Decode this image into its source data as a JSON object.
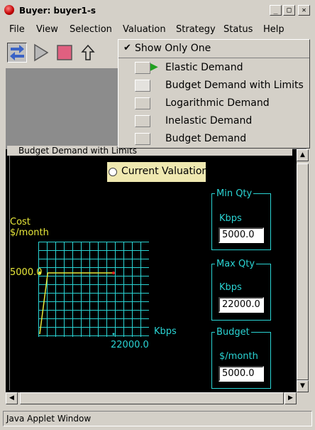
{
  "window": {
    "title": "Buyer: buyer1-s",
    "minimize_glyph": "_",
    "maximize_glyph": "□",
    "close_glyph": "✕"
  },
  "menu": [
    "File",
    "View",
    "Selection",
    "Valuation",
    "Strategy",
    "Status",
    "Help"
  ],
  "toolbar": {
    "buttons": [
      "swap-icon",
      "play-icon",
      "stop-icon",
      "up-arrow-icon"
    ]
  },
  "valuation_menu": {
    "show_only_one": {
      "check": "✔",
      "label": "Show Only One",
      "checked": true
    },
    "items": [
      {
        "label": "Elastic Demand",
        "active": true,
        "marker": "▶"
      },
      {
        "label": "Budget Demand with Limits",
        "active": false
      },
      {
        "label": "Logarithmic Demand",
        "active": false
      },
      {
        "label": "Inelastic Demand",
        "active": false
      },
      {
        "label": "Budget Demand",
        "active": false
      }
    ]
  },
  "panel": {
    "title": "Budget Demand with Limits",
    "current_valuation_label": "Current Valuation",
    "cost_label": "Cost",
    "cost_unit": "$/month",
    "y_tick": "5000.0",
    "x_axis_label": "Kbps",
    "x_tick": "22000.0"
  },
  "chart_data": {
    "type": "line",
    "x": [
      0,
      1200,
      2400,
      22000
    ],
    "y": [
      0,
      2500,
      5000,
      5000
    ],
    "xlabel": "Kbps",
    "ylabel": "Cost $/month",
    "marked_x": 22000.0,
    "marked_y": 5000.0,
    "grid": true
  },
  "min_qty": {
    "title": "Min Qty",
    "unit": "Kbps",
    "value": "5000.0"
  },
  "max_qty": {
    "title": "Max Qty",
    "unit": "Kbps",
    "value": "22000.0"
  },
  "budget": {
    "title": "Budget",
    "unit": "$/month",
    "value": "5000.0"
  },
  "status_bar": "Java Applet Window"
}
